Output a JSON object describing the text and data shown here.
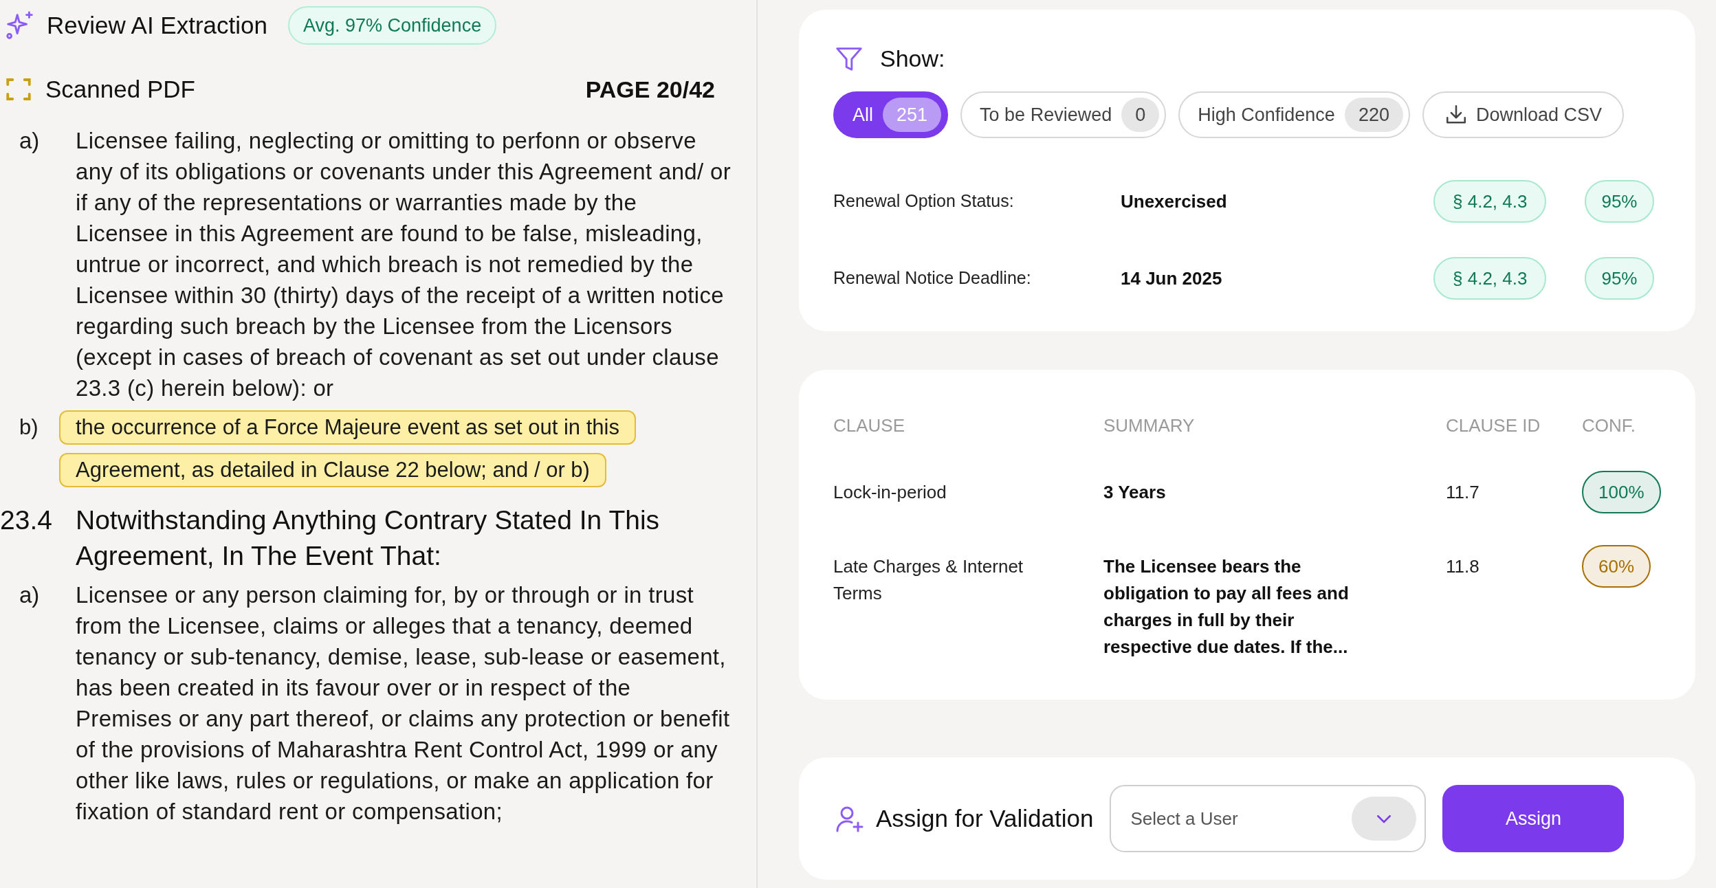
{
  "header": {
    "title": "Review AI Extraction",
    "confidence_badge": "Avg. 97% Confidence"
  },
  "document": {
    "source": "Scanned PDF",
    "page": "PAGE 20/42",
    "blocks": [
      {
        "kind": "item",
        "marker": "a)",
        "text": "Licensee failing, neglecting or omitting to perfonn or observe any of its obligations or covenants under this Agreement and/ or if any of the representations or warranties made by the Licensee in this Agreement are found to be false, misleading, untrue or incorrect, and which breach is not remedied by the Licensee within 30 (thirty) days of the receipt of a written notice regarding such breach by the Licensee from the Licensors (except in cases of breach of covenant as set out under clause 23.3 (c) herein below): or"
      },
      {
        "kind": "highlight",
        "marker": "b)",
        "lines": [
          "the occurrence of a Force Majeure event as set out in this",
          "Agreement, as detailed in Clause 22 below; and / or b)"
        ]
      },
      {
        "kind": "heading",
        "marker": "23.4",
        "text": "Notwithstanding Anything Contrary Stated In This Agreement, In The Event That:"
      },
      {
        "kind": "item",
        "marker": "a)",
        "text": "Licensee or any person claiming for, by or through or in trust from the Licensee, claims or alleges that a tenancy, deemed tenancy or sub-tenancy, demise, lease, sub-lease or easement, has been created in its favour over or in respect of the Premises or any part thereof, or claims any protection or benefit of the provisions of Maharashtra Rent Control Act, 1999 or any other like laws, rules or regulations, or make an application for fixation of standard rent or compensation;"
      }
    ]
  },
  "filters": {
    "title": "Show:",
    "chips": [
      {
        "label": "All",
        "count": "251",
        "selected": true
      },
      {
        "label": "To be Reviewed",
        "count": "0",
        "selected": false
      },
      {
        "label": "High Confidence",
        "count": "220",
        "selected": false
      }
    ],
    "download": "Download CSV",
    "fields": [
      {
        "label": "Renewal Option Status:",
        "value": "Unexercised",
        "section": "§ 4.2, 4.3",
        "confidence": "95%"
      },
      {
        "label": "Renewal Notice Deadline:",
        "value": "14 Jun 2025",
        "section": "§ 4.2, 4.3",
        "confidence": "95%"
      }
    ]
  },
  "table": {
    "columns": [
      "CLAUSE",
      "SUMMARY",
      "CLAUSE ID",
      "CONF."
    ],
    "rows": [
      {
        "clause": "Lock-in-period",
        "summary": "3 Years",
        "clause_id": "11.7",
        "conf": "100%",
        "color": "#0f7a55"
      },
      {
        "clause": "Late Charges & Internet Terms",
        "summary": "The Licensee bears the obligation to pay all fees and charges in full by their respective due dates. If the...",
        "clause_id": "11.8",
        "conf": "60%",
        "color": "#a86f00"
      }
    ]
  },
  "assign": {
    "title": "Assign for Validation",
    "placeholder": "Select a User",
    "button": "Assign"
  }
}
